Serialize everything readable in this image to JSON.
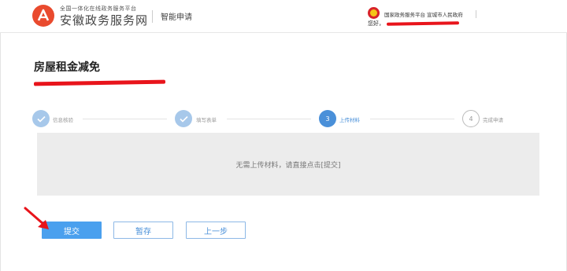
{
  "header": {
    "brand_small": "全国一体化在线政务服务平台",
    "brand_big": "安徽政务服务网",
    "subtitle": "智能申请",
    "gov_platform": "国家政务服务平台 宣城市人民政府",
    "greeting": "您好，"
  },
  "page": {
    "title": "房屋租金减免"
  },
  "steps": [
    {
      "label": "信息核验",
      "number": "",
      "status": "done"
    },
    {
      "label": "填写表单",
      "number": "",
      "status": "done"
    },
    {
      "label": "上传材料",
      "number": "3",
      "status": "active"
    },
    {
      "label": "完成申请",
      "number": "4",
      "status": "todo"
    }
  ],
  "content": {
    "message": "无需上传材料，请直接点击[提交]"
  },
  "buttons": {
    "submit": "提交",
    "save_draft": "暂存",
    "prev_step": "上一步"
  },
  "colors": {
    "primary": "#4aa0ee",
    "accent": "#4a90d9",
    "done_step": "#a7c8ea",
    "annotation": "#e8141b",
    "logo": "#e94a2e"
  }
}
